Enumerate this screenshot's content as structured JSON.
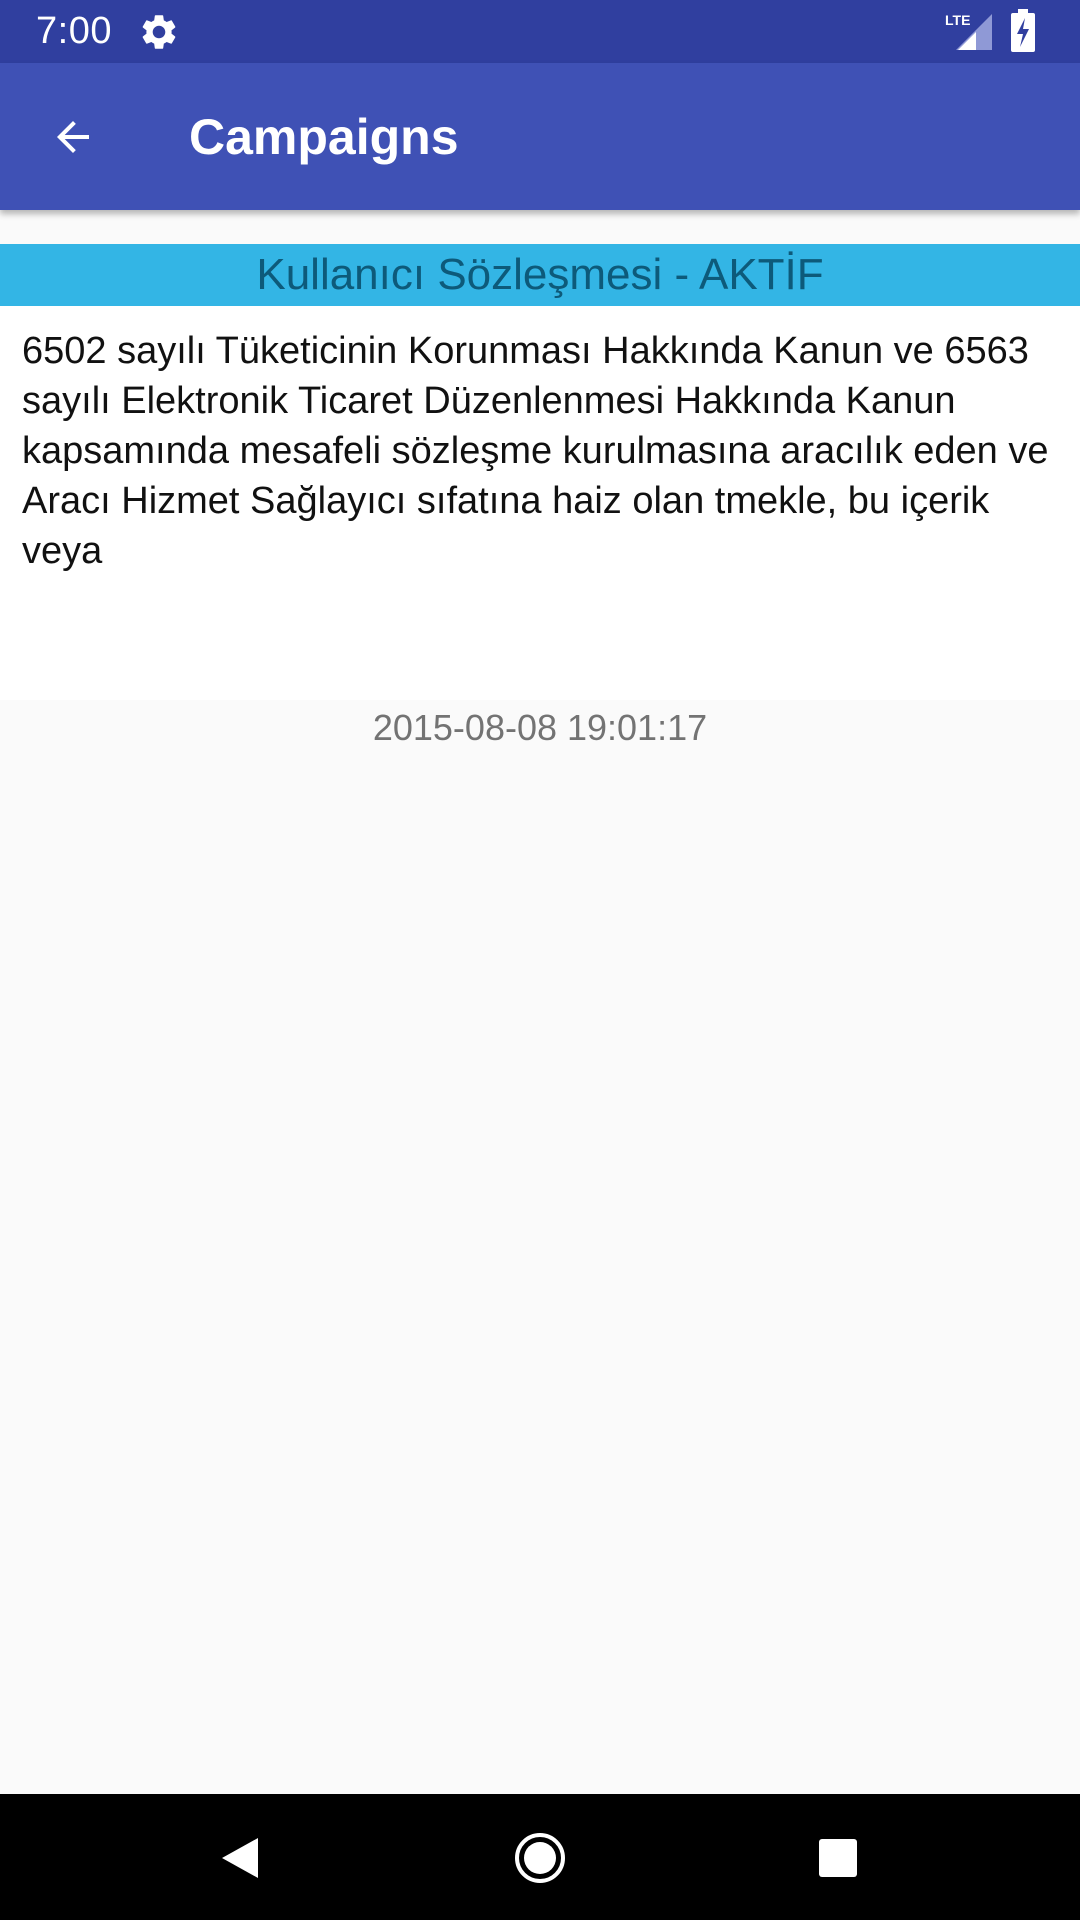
{
  "status_bar": {
    "time": "7:00",
    "icons": [
      "settings-gear-icon",
      "lte-signal-icon",
      "battery-charging-icon"
    ],
    "network_label": "LTE"
  },
  "app_bar": {
    "title": "Campaigns",
    "back_icon": "arrow-back-icon",
    "color": "#3f51b5"
  },
  "campaign": {
    "title": "Kullanıcı Sözleşmesi - AKTİF",
    "body": "6502 sayılı Tüketicinin Korunması Hakkında Kanun ve 6563 sayılı Elektronik Ticaret Düzenlenmesi Hakkında Kanun kapsamında mesafeli sözleşme kurulmasına aracılık eden ve Aracı Hizmet Sağlayıcı sıfatına haiz olan tmekle, bu içerik veya",
    "date": "2015-08-08 19:01:17",
    "header_color": "#33b5e5"
  },
  "nav_bar": {
    "buttons": [
      "back-triangle-icon",
      "home-circle-icon",
      "recents-square-icon"
    ]
  }
}
